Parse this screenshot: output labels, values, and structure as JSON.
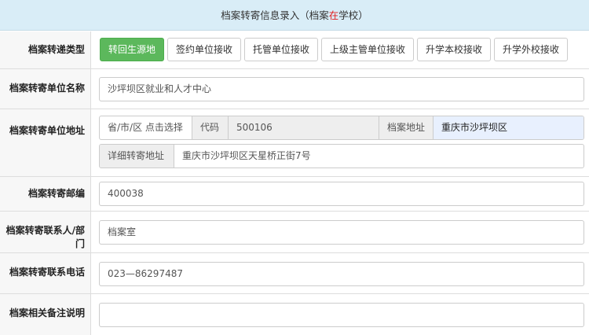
{
  "header": {
    "title_prefix": "档案转寄信息录入（档案",
    "title_highlight": "在",
    "title_suffix": "学校）"
  },
  "colors": {
    "header_bg": "#d9edf7",
    "active_btn": "#5cb85c",
    "highlight_text": "#e02020",
    "address_bg": "#e8f0fe"
  },
  "transfer_type": {
    "label": "档案转递类型",
    "options": [
      "转回生源地",
      "签约单位接收",
      "托管单位接收",
      "上级主管单位接收",
      "升学本校接收",
      "升学外校接收"
    ],
    "selected": "转回生源地"
  },
  "unit_name": {
    "label": "档案转寄单位名称",
    "value": "沙坪坝区就业和人才中心"
  },
  "unit_address": {
    "label": "档案转寄单位地址",
    "region_picker": "省/市/区 点击选择",
    "code_label": "代码",
    "code_value": "500106",
    "archive_addr_label": "档案地址",
    "archive_addr_value": "重庆市沙坪坝区",
    "detail_label": "详细转寄地址",
    "detail_value": "重庆市沙坪坝区天星桥正街7号"
  },
  "postcode": {
    "label": "档案转寄邮编",
    "value": "400038"
  },
  "contact": {
    "label": "档案转寄联系人/部门",
    "value": "档案室"
  },
  "phone": {
    "label": "档案转寄联系电话",
    "value": "023—86297487"
  },
  "remarks": {
    "label": "档案相关备注说明",
    "value": ""
  }
}
